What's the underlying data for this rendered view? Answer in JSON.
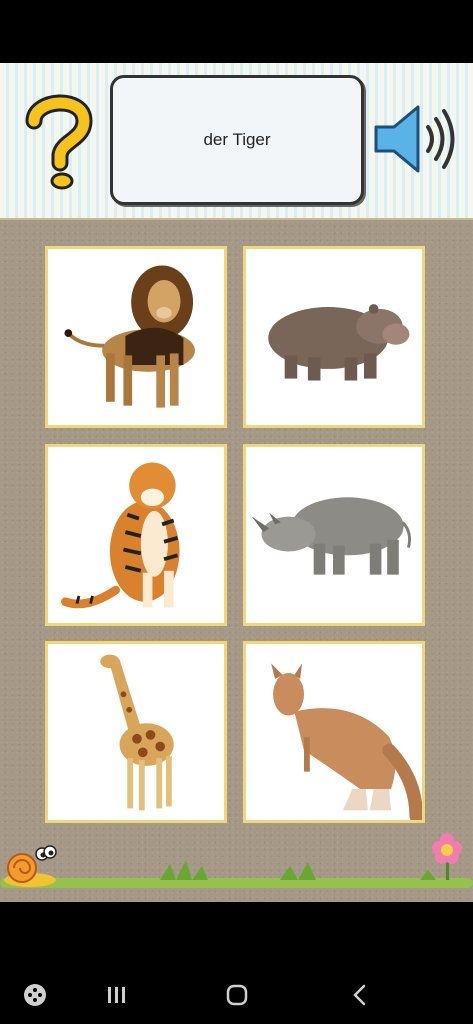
{
  "prompt": {
    "word": "der Tiger"
  },
  "icons": {
    "hint": "question-mark-icon",
    "audio": "speaker-icon",
    "snail": "snail-icon",
    "flower": "flower-icon"
  },
  "tiles": [
    {
      "animal": "lion"
    },
    {
      "animal": "hippopotamus"
    },
    {
      "animal": "tiger"
    },
    {
      "animal": "rhinoceros"
    },
    {
      "animal": "giraffe"
    },
    {
      "animal": "kangaroo"
    }
  ],
  "nav": [
    "game-launcher-icon",
    "recent-apps-icon",
    "home-icon",
    "back-icon"
  ],
  "colors": {
    "tile_border": "#f0d87a",
    "board": "#a59887",
    "accent": "#f6c21c"
  }
}
